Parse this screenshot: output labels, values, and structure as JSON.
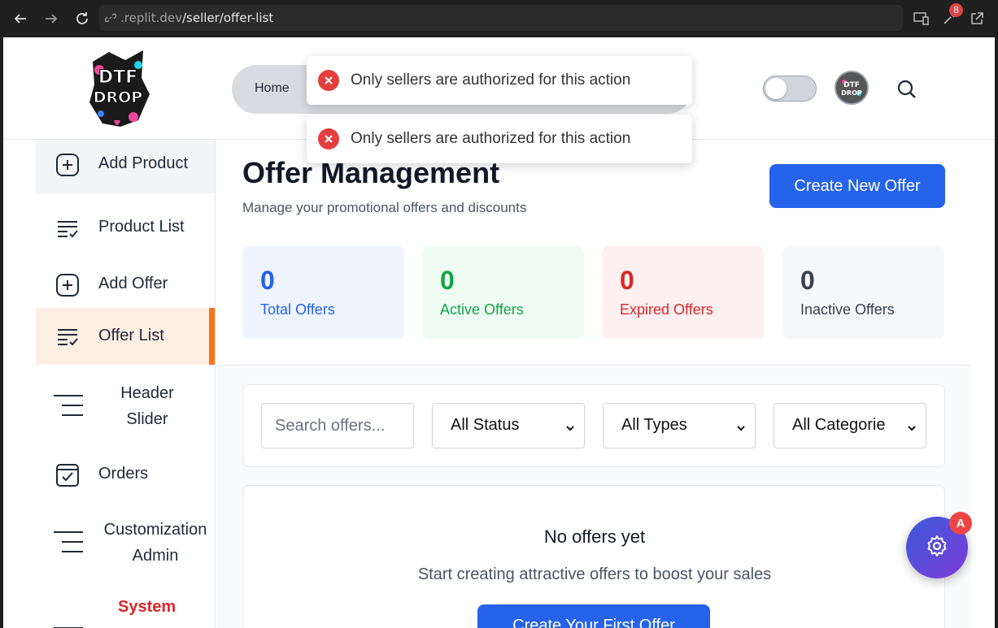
{
  "browser": {
    "url_host": ".replit.dev",
    "url_path": "/seller/offer-list",
    "extension_badge": "8"
  },
  "header": {
    "logo_alt": "DTF DROP",
    "nav_home": "Home",
    "theme_toggle_on": false
  },
  "toasts": [
    {
      "message": "Only sellers are authorized for this action"
    },
    {
      "message": "Only sellers are authorized for this action"
    }
  ],
  "sidebar": {
    "items": [
      {
        "label": "Add Product",
        "icon": "plus-square-icon"
      },
      {
        "label": "Product List",
        "icon": "list-check-icon"
      },
      {
        "label": "Add Offer",
        "icon": "plus-square-icon"
      },
      {
        "label": "Offer List",
        "icon": "list-check-icon",
        "active": true
      },
      {
        "label_line1": "Header",
        "label_line2": "Slider",
        "icon": "menu-lines-icon"
      },
      {
        "label": "Orders",
        "icon": "checkbox-icon"
      },
      {
        "label_line1": "Customization",
        "label_line2": "Admin",
        "icon": "menu-lines-icon"
      },
      {
        "label": "System",
        "icon": "menu-lines-icon",
        "color": "#dc2626"
      }
    ]
  },
  "main": {
    "title": "Offer Management",
    "subtitle": "Manage your promotional offers and discounts",
    "create_button": "Create New Offer",
    "stats": [
      {
        "value": "0",
        "label": "Total Offers",
        "color": "#2563eb",
        "bg": "#eff5ff"
      },
      {
        "value": "0",
        "label": "Active Offers",
        "color": "#16a34a",
        "bg": "#eefcf3"
      },
      {
        "value": "0",
        "label": "Expired Offers",
        "color": "#dc2626",
        "bg": "#fef0f0"
      },
      {
        "value": "0",
        "label": "Inactive Offers",
        "color": "#374151",
        "bg": "#f6f7f9"
      }
    ],
    "filters": {
      "search_placeholder": "Search offers...",
      "status": "All Status",
      "types": "All Types",
      "categories": "All Categorie"
    },
    "empty": {
      "title": "No offers yet",
      "subtitle": "Start creating attractive offers to boost your sales",
      "button": "Create Your First Offer"
    }
  },
  "fab": {
    "badge": "A",
    "icon": "gear-icon"
  }
}
